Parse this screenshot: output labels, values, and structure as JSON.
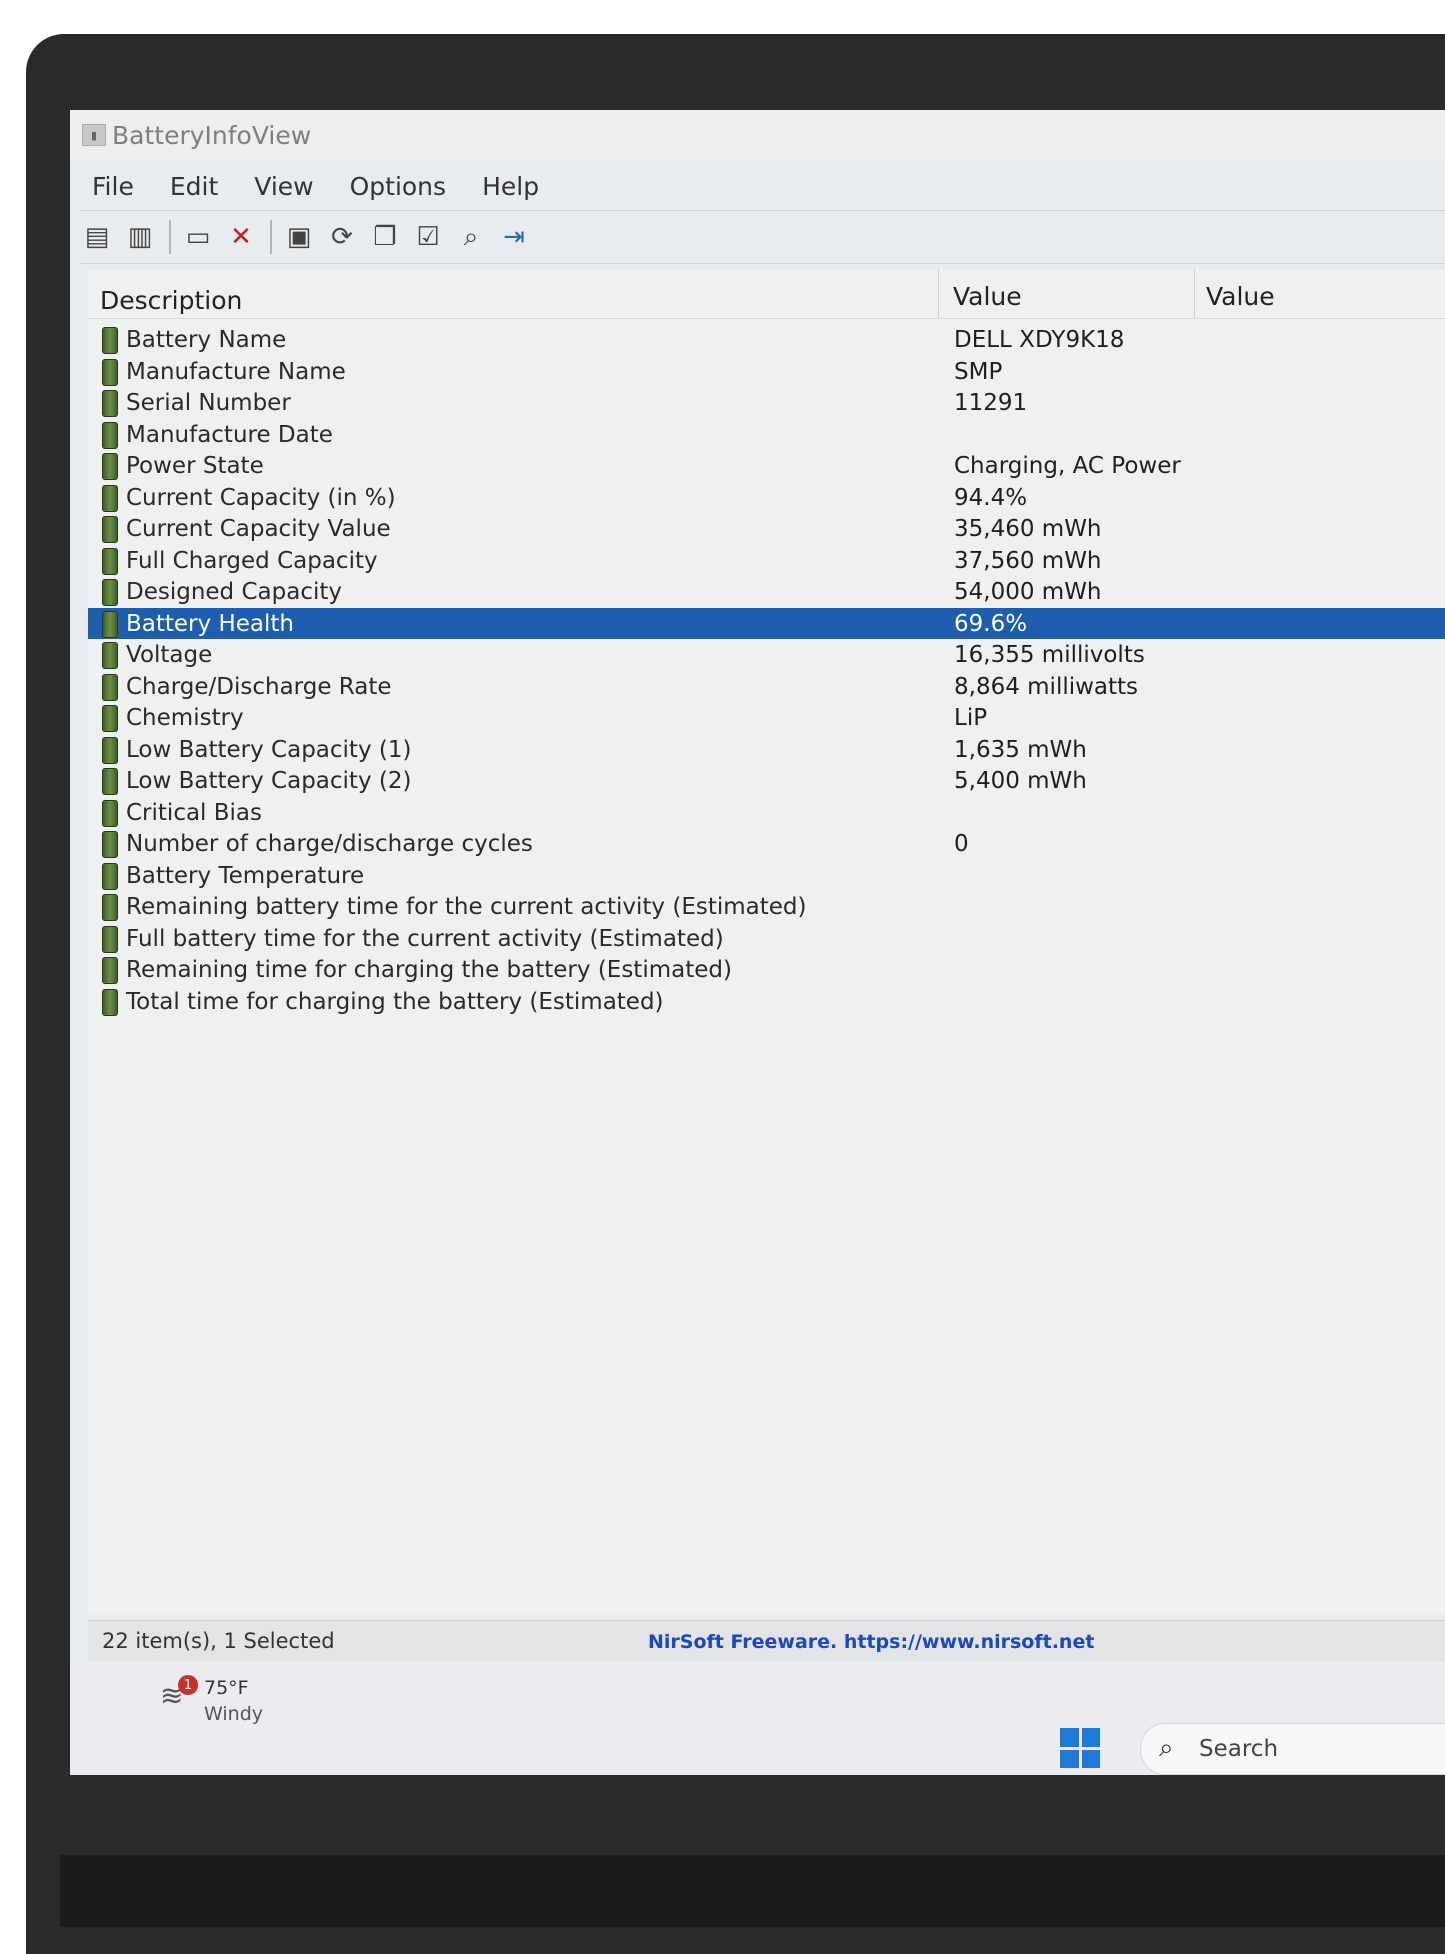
{
  "window": {
    "title": "BatteryInfoView"
  },
  "menu": [
    "File",
    "Edit",
    "View",
    "Options",
    "Help"
  ],
  "toolbar": {
    "buttons": [
      "properties-icon",
      "copy-icon",
      "report-icon",
      "delete-icon",
      "save-icon",
      "refresh-icon",
      "copy-rows-icon",
      "options-icon",
      "find-icon",
      "exit-icon"
    ]
  },
  "columns": {
    "description": "Description",
    "value1": "Value",
    "value2": "Value"
  },
  "rows": [
    {
      "description": "Battery Name",
      "value": "DELL XDY9K18"
    },
    {
      "description": "Manufacture Name",
      "value": "SMP"
    },
    {
      "description": "Serial Number",
      "value": "11291"
    },
    {
      "description": "Manufacture Date",
      "value": ""
    },
    {
      "description": "Power State",
      "value": "Charging, AC Power"
    },
    {
      "description": "Current Capacity (in %)",
      "value": "94.4%"
    },
    {
      "description": "Current Capacity Value",
      "value": "35,460 mWh"
    },
    {
      "description": "Full Charged Capacity",
      "value": "37,560 mWh"
    },
    {
      "description": "Designed Capacity",
      "value": "54,000 mWh"
    },
    {
      "description": "Battery Health",
      "value": "69.6%"
    },
    {
      "description": "Voltage",
      "value": "16,355 millivolts"
    },
    {
      "description": "Charge/Discharge Rate",
      "value": "8,864 milliwatts"
    },
    {
      "description": "Chemistry",
      "value": "LiP"
    },
    {
      "description": "Low Battery Capacity (1)",
      "value": "1,635 mWh"
    },
    {
      "description": "Low Battery Capacity (2)",
      "value": "5,400 mWh"
    },
    {
      "description": "Critical Bias",
      "value": ""
    },
    {
      "description": "Number of charge/discharge cycles",
      "value": "0"
    },
    {
      "description": "Battery Temperature",
      "value": ""
    },
    {
      "description": "Remaining battery time for the current activity (Estimated)",
      "value": ""
    },
    {
      "description": "Full battery time for the current activity (Estimated)",
      "value": ""
    },
    {
      "description": "Remaining time for charging the battery (Estimated)",
      "value": ""
    },
    {
      "description": "Total  time for charging the battery (Estimated)",
      "value": ""
    }
  ],
  "selected_index": 9,
  "status": {
    "items": "22 item(s), 1 Selected",
    "link": "NirSoft Freeware. https://www.nirsoft.net"
  },
  "taskbar": {
    "weather_badge": "1",
    "weather_temp": "75°F",
    "weather_condition": "Windy",
    "search_label": "Search"
  },
  "colors": {
    "selection": "#1e5eae",
    "link": "#1a49c6",
    "battery_icon": "#4f7a32"
  }
}
